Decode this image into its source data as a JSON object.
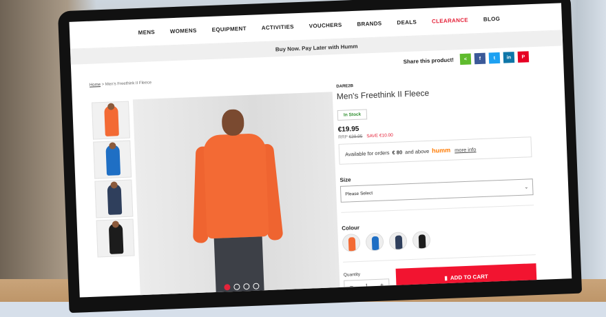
{
  "nav": {
    "items": [
      "MENS",
      "WOMENS",
      "EQUIPMENT",
      "ACTIVITIES",
      "VOUCHERS",
      "BRANDS",
      "DEALS",
      "CLEARANCE",
      "BLOG"
    ],
    "highlight_color": "#e5233a"
  },
  "promo": {
    "text": "Buy Now. Pay Later with Humm"
  },
  "share": {
    "label": "Share this product!",
    "icons": [
      {
        "name": "share-icon",
        "glyph": "<",
        "color": "#5fbb2d"
      },
      {
        "name": "facebook-icon",
        "glyph": "f",
        "color": "#3b5998"
      },
      {
        "name": "twitter-icon",
        "glyph": "t",
        "color": "#1da1f2"
      },
      {
        "name": "linkedin-icon",
        "glyph": "in",
        "color": "#0e76a8"
      },
      {
        "name": "pinterest-icon",
        "glyph": "P",
        "color": "#e60023"
      }
    ]
  },
  "breadcrumb": {
    "home": "Home",
    "sep": " > ",
    "current": "Men's Freethink II Fleece"
  },
  "product": {
    "brand": "DARE2B",
    "title": "Men's Freethink II Fleece",
    "stock": "In Stock",
    "price": "€19.95",
    "rrp_label": "RRP",
    "rrp": "€29.95",
    "save": "SAVE €10.00",
    "humm_text_1": "Available for orders",
    "humm_amount": "€ 80",
    "humm_text_2": "and above",
    "humm_logo": "humm",
    "humm_link": "more info",
    "size_label": "Size",
    "size_placeholder": "Please Select",
    "colour_label": "Colour",
    "swatch_colors": [
      "#f36a34",
      "#1f6fc4",
      "#2f3f5c",
      "#1c1c1c"
    ],
    "quantity_label": "Quantity",
    "quantity_value": "1",
    "cart_button": "ADD TO CART",
    "thumb_colors": [
      "#f36a34",
      "#1f6fc4",
      "#2f3f5c",
      "#1c1c1c"
    ]
  },
  "gallery": {
    "dots": 4,
    "active_dot": 0
  }
}
